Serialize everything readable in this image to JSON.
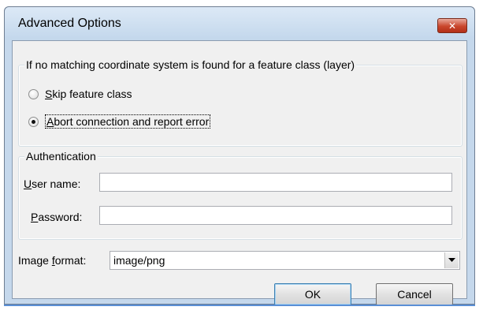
{
  "window": {
    "title": "Advanced Options",
    "close_glyph": "✕"
  },
  "coordinate_group": {
    "legend": "If no matching coordinate system is found for a feature class (layer)",
    "options": [
      {
        "mnemonic": "S",
        "rest": "kip feature class",
        "checked": false
      },
      {
        "mnemonic": "A",
        "rest": "bort connection and report error",
        "checked": true
      }
    ]
  },
  "auth_group": {
    "legend": "Authentication",
    "user": {
      "mnemonic": "U",
      "rest": "ser name:",
      "value": ""
    },
    "password": {
      "mnemonic": "P",
      "rest": "assword:",
      "value": ""
    }
  },
  "image_format": {
    "label_pre": "Image ",
    "mnemonic": "f",
    "label_post": "ormat:",
    "value": "image/png"
  },
  "buttons": {
    "ok": "OK",
    "cancel": "Cancel"
  },
  "colors": {
    "title_bar": "#c3d7ec",
    "close_button": "#c9462c",
    "client": "#f0f0f0"
  }
}
